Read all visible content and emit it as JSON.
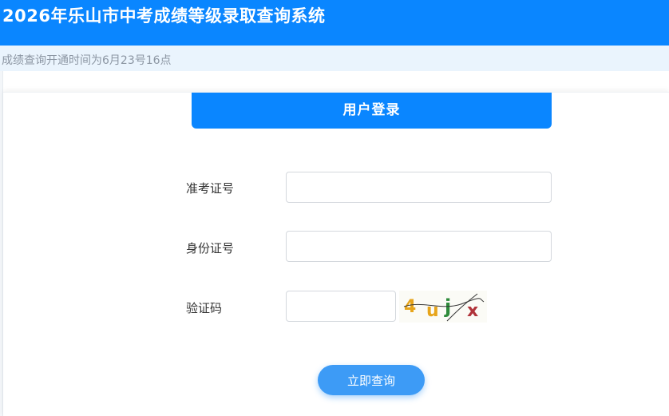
{
  "header": {
    "title": "2026年乐山市中考成绩等级录取查询系统",
    "background": "#0a86ff"
  },
  "notice": {
    "text": "成绩查询开通时间为6月23号16点"
  },
  "login": {
    "title": "用户登录",
    "fields": {
      "exam_number": {
        "label": "准考证号",
        "value": "",
        "placeholder": ""
      },
      "id_number": {
        "label": "身份证号",
        "value": "",
        "placeholder": ""
      },
      "captcha": {
        "label": "验证码",
        "value": "",
        "placeholder": ""
      }
    },
    "captcha_image": {
      "characters": [
        "4",
        "u",
        "j",
        "x"
      ],
      "colors": [
        "#e7a51b",
        "#e7a51b",
        "#2e8b3a",
        "#b0333a"
      ]
    },
    "submit_label": "立即查询"
  },
  "colors": {
    "primary": "#0a86ff",
    "button": "#3d9bf6",
    "notice_bg": "#eaf4fd"
  }
}
